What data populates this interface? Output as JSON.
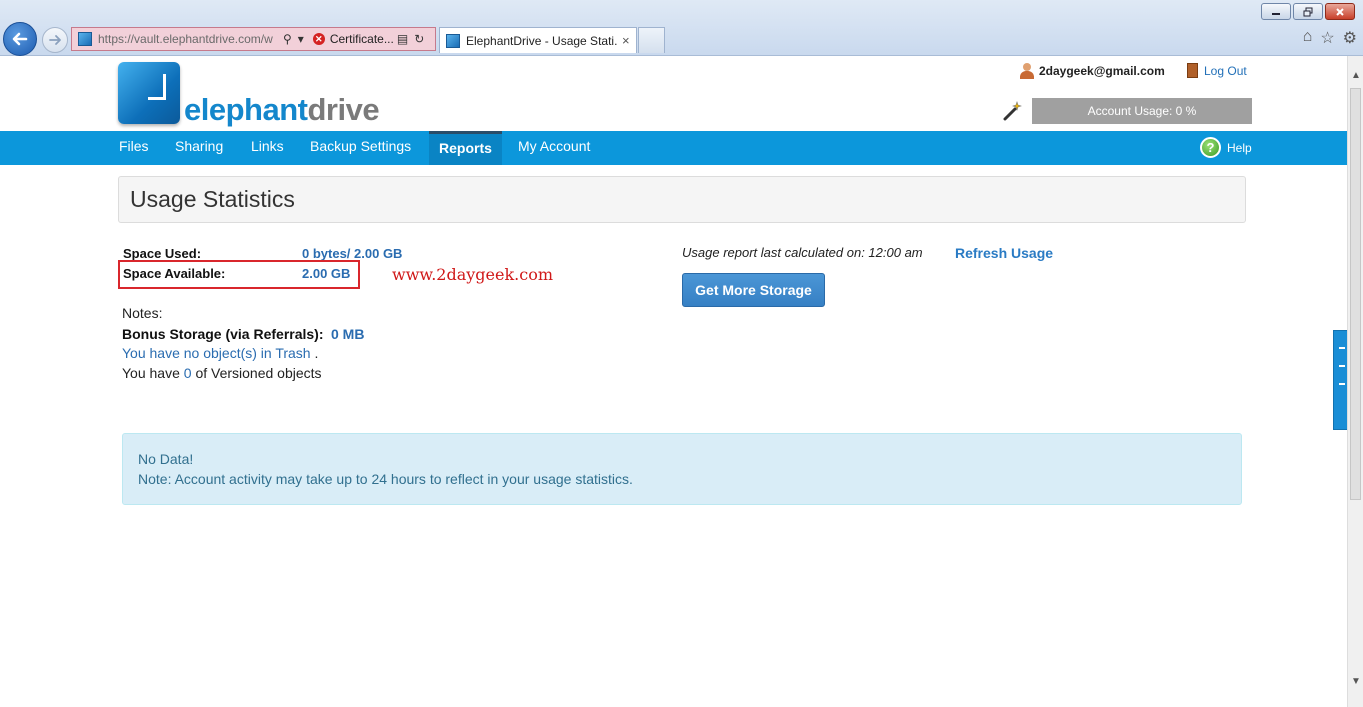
{
  "browser": {
    "url": "https://vault.elephantdrive.com/w",
    "cert_label": "Certificate...",
    "tab_title": "ElephantDrive - Usage Stati...",
    "tab_close": "×"
  },
  "header": {
    "logo_part1": "elephant",
    "logo_part2": "drive",
    "user_email": "2daygeek@gmail.com",
    "logout_label": "Log Out",
    "account_usage": "Account Usage: 0 %"
  },
  "nav": {
    "items": [
      {
        "label": "Files"
      },
      {
        "label": "Sharing"
      },
      {
        "label": "Links"
      },
      {
        "label": "Backup Settings"
      },
      {
        "label": "Reports"
      },
      {
        "label": "My Account"
      }
    ],
    "active": "Reports",
    "help_label": "Help"
  },
  "page": {
    "title": "Usage Statistics"
  },
  "stats": {
    "space_used_label": "Space Used:",
    "space_used_value": "0 bytes/ 2.00 GB",
    "space_available_label": "Space Available:",
    "space_available_value": "2.00 GB",
    "watermark": "www.2daygeek.com",
    "notes_label": "Notes:",
    "bonus_label": "Bonus Storage (via Referrals):",
    "bonus_value": "0 MB",
    "trash_text": "You have no object(s) in Trash",
    "trash_suffix": ".",
    "versioned_prefix": "You have",
    "versioned_count": "0",
    "versioned_suffix": "of Versioned objects"
  },
  "report": {
    "calc_text": "Usage report last calculated on: 12:00 am",
    "refresh_label": "Refresh Usage",
    "more_storage_label": "Get More Storage"
  },
  "alert": {
    "title": "No Data!",
    "note": "Note: Account activity may take up to 24 hours to reflect in your usage statistics."
  },
  "colors": {
    "navbar": "#0c97db",
    "link": "#2a6cb0",
    "highlight": "#d9262c",
    "alert_bg": "#d9edf7"
  }
}
